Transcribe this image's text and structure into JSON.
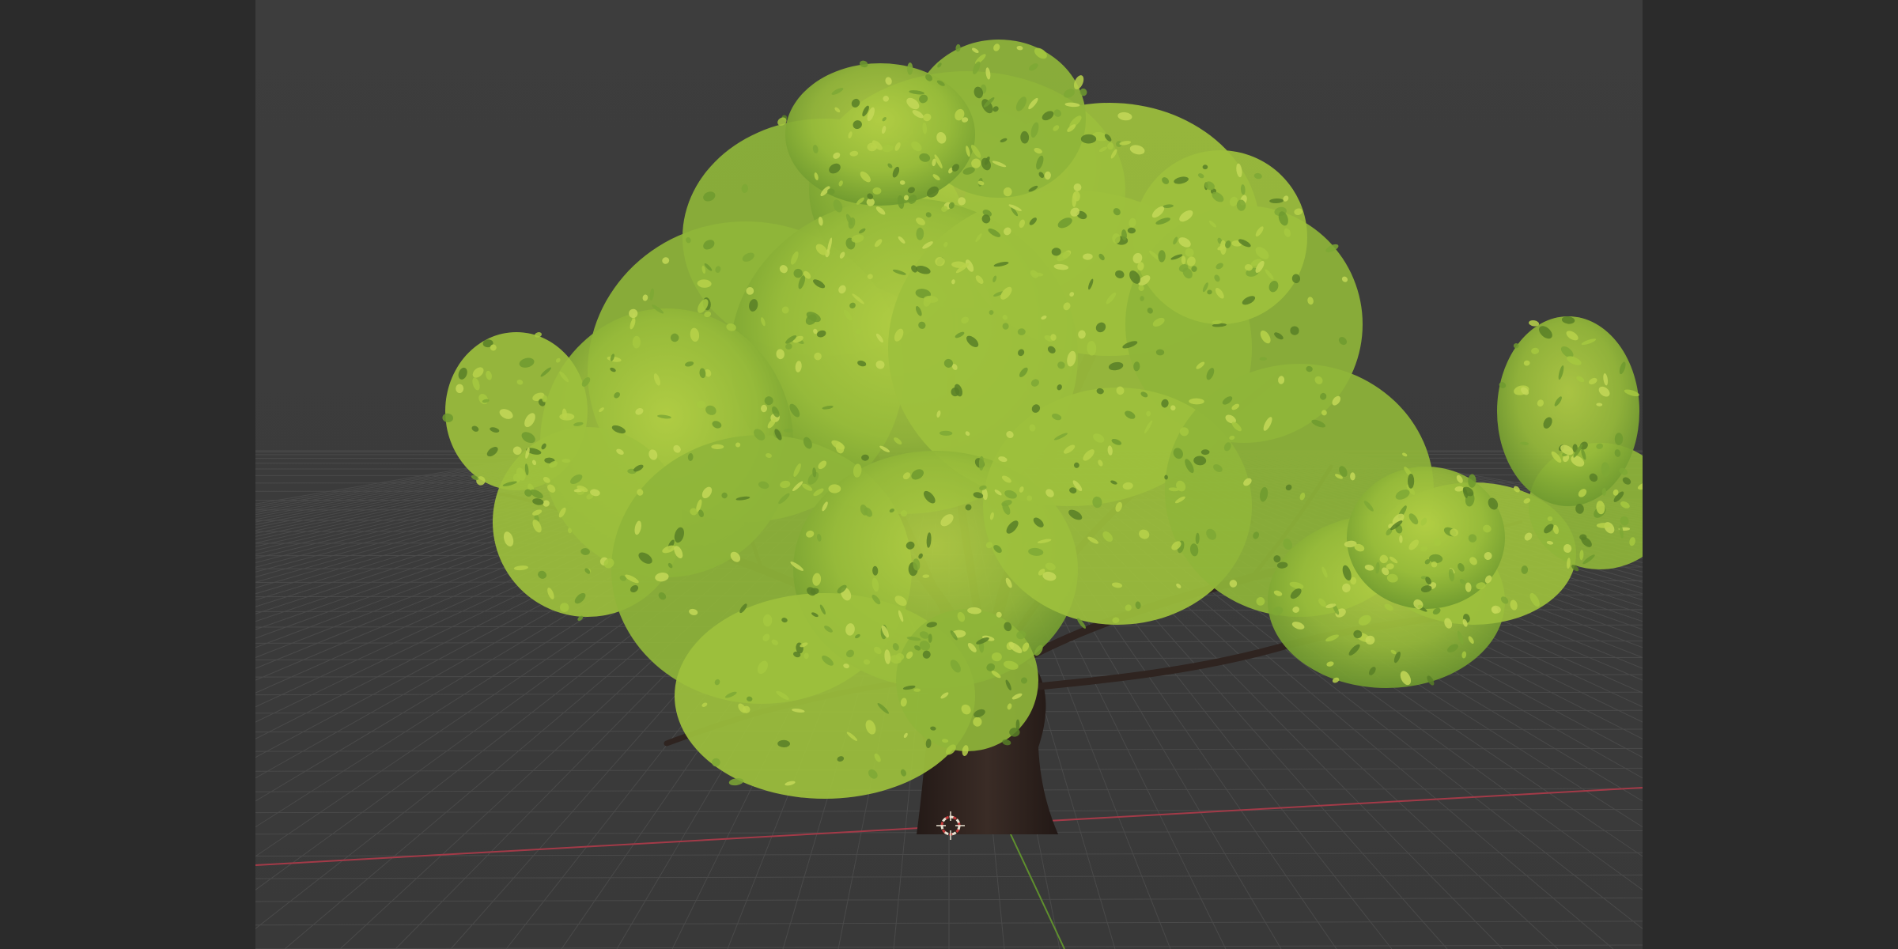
{
  "app": {
    "view": "3D Viewport",
    "object": "tree-model",
    "overlays": {
      "floor_grid": true,
      "axis_x": true,
      "axis_y": true,
      "cursor_3d": true
    }
  },
  "colors": {
    "background_outer": "#2b2b2b",
    "viewport_background": "#3c3c3c",
    "grid_line": "#4a4a4a",
    "axis_x": "#a33a48",
    "axis_y": "#5f8f2e",
    "foliage_light": "#a9c83c",
    "foliage_mid": "#8fb53a",
    "foliage_dark": "#5f8e2c",
    "bark": "#2f2420",
    "cursor_ring": "#e8e0d0",
    "cursor_accent": "#c13a3a"
  },
  "icons": {
    "cursor": "3d-cursor-icon"
  }
}
